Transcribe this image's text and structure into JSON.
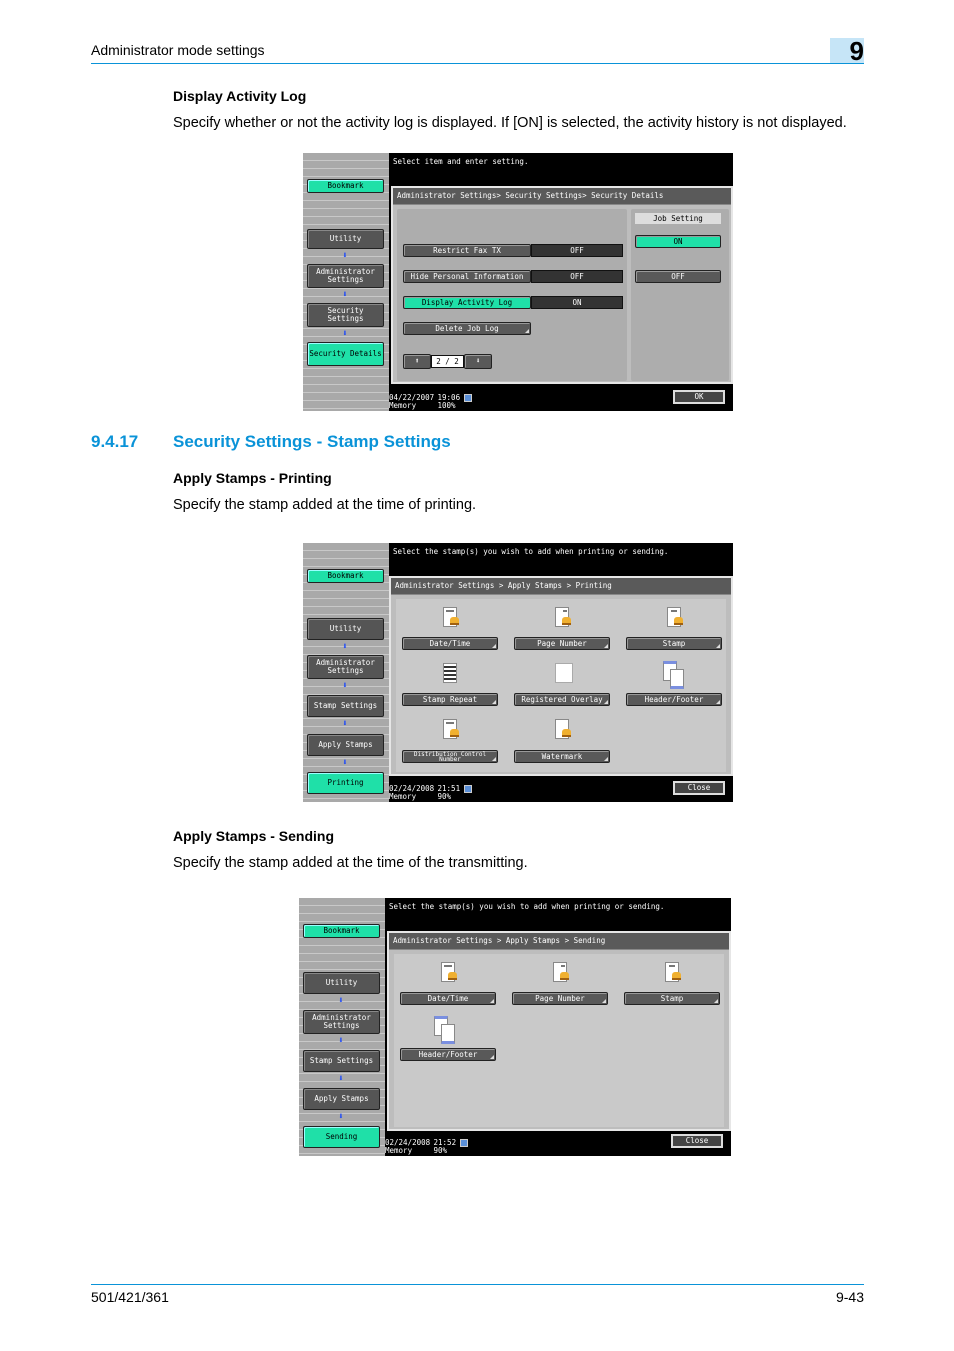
{
  "header": {
    "section": "Administrator mode settings",
    "chapter": "9"
  },
  "block1": {
    "heading": "Display Activity Log",
    "text": "Specify whether or not the activity log is displayed. If [ON] is selected, the activity history is not displayed.",
    "screen": {
      "message": "Select item and enter setting.",
      "bookmark": "Bookmark",
      "nav": [
        "Utility",
        "Administrator Settings",
        "Security Settings",
        "Security Details"
      ],
      "breadcrumb": "Administrator Settings> Security Settings> Security Details",
      "rows": [
        {
          "label": "Restrict Fax TX",
          "value": "OFF"
        },
        {
          "label": "Hide Personal Information",
          "value": "OFF"
        },
        {
          "label": "Display Activity Log",
          "value": "ON"
        },
        {
          "label": "Delete Job Log",
          "value": ""
        }
      ],
      "job_setting": {
        "title": "Job Setting",
        "on": "ON",
        "off": "OFF"
      },
      "page": "2 / 2",
      "date": "04/22/2007",
      "time": "19:06",
      "memory_label": "Memory",
      "memory": "100%",
      "ok": "OK"
    }
  },
  "section": {
    "number": "9.4.17",
    "title": "Security Settings - Stamp Settings"
  },
  "block2": {
    "heading": "Apply Stamps - Printing",
    "text": "Specify the stamp added at the time of printing.",
    "screen": {
      "message": "Select the stamp(s) you wish to add when printing or sending.",
      "bookmark": "Bookmark",
      "nav": [
        "Utility",
        "Administrator Settings",
        "Stamp Settings",
        "Apply Stamps",
        "Printing"
      ],
      "breadcrumb": "Administrator Settings > Apply Stamps > Printing",
      "items": [
        "Date/Time",
        "Page Number",
        "Stamp",
        "Stamp Repeat",
        "Registered Overlay",
        "Header/Footer",
        "Distribution Control Number",
        "Watermark"
      ],
      "date": "02/24/2008",
      "time": "21:51",
      "memory_label": "Memory",
      "memory": "90%",
      "close": "Close"
    }
  },
  "block3": {
    "heading": "Apply Stamps - Sending",
    "text": "Specify the stamp added at the time of the transmitting.",
    "screen": {
      "message": "Select the stamp(s) you wish to add when printing or sending.",
      "bookmark": "Bookmark",
      "nav": [
        "Utility",
        "Administrator Settings",
        "Stamp Settings",
        "Apply Stamps",
        "Sending"
      ],
      "breadcrumb": "Administrator Settings > Apply Stamps > Sending",
      "items": [
        "Date/Time",
        "Page Number",
        "Stamp",
        "Header/Footer"
      ],
      "date": "02/24/2008",
      "time": "21:52",
      "memory_label": "Memory",
      "memory": "90%",
      "close": "Close"
    }
  },
  "footer": {
    "model": "501/421/361",
    "page": "9-43"
  }
}
